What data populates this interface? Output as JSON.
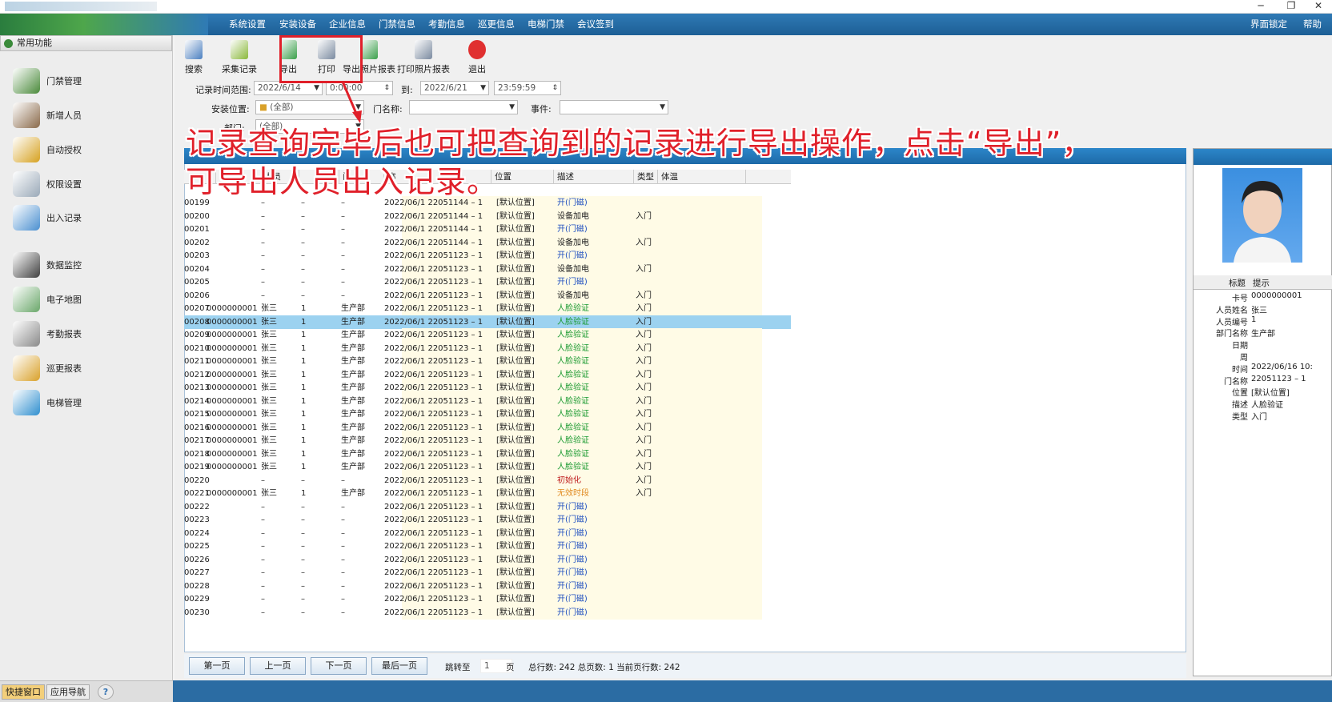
{
  "window": {
    "controls": [
      "─",
      "❐",
      "✕"
    ]
  },
  "menu": {
    "items": [
      "系统设置",
      "安装设备",
      "企业信息",
      "门禁信息",
      "考勤信息",
      "巡更信息",
      "电梯门禁",
      "会议签到"
    ],
    "right": [
      "界面锁定",
      "帮助"
    ]
  },
  "sidebar": {
    "header": "常用功能",
    "items": [
      {
        "label": "门禁管理",
        "icon": "door-control-icon",
        "color": "#4a8a3a"
      },
      {
        "label": "新增人员",
        "icon": "add-person-icon",
        "color": "#8a6a4a"
      },
      {
        "label": "自动授权",
        "icon": "auto-auth-icon",
        "color": "#d6a11f"
      },
      {
        "label": "权限设置",
        "icon": "permission-icon",
        "color": "#9aa9b8"
      },
      {
        "label": "出入记录",
        "icon": "access-record-icon",
        "color": "#4a8fd0"
      },
      {
        "label": "数据监控",
        "icon": "camera-icon",
        "color": "#404040"
      },
      {
        "label": "电子地图",
        "icon": "map-icon",
        "color": "#6aa76a"
      },
      {
        "label": "考勤报表",
        "icon": "clock-icon",
        "color": "#8a8a8a"
      },
      {
        "label": "巡更报表",
        "icon": "patrol-icon",
        "color": "#d9a12a"
      },
      {
        "label": "电梯管理",
        "icon": "elevator-icon",
        "color": "#2f8fcf"
      }
    ],
    "bottom": [
      "快捷窗口",
      "应用导航",
      "?"
    ]
  },
  "toolbar": {
    "buttons": [
      {
        "label": "搜索",
        "icon": "search-icon",
        "color": "#4a7fc0"
      },
      {
        "label": "采集记录",
        "icon": "collect-icon",
        "color": "#8ab83a"
      },
      {
        "label": "导出",
        "icon": "export-icon",
        "color": "#3aa04a"
      },
      {
        "label": "打印",
        "icon": "print-icon",
        "color": "#7a8aa0"
      },
      {
        "label": "导出照片报表",
        "icon": "export-photo-icon",
        "color": "#3aa04a"
      },
      {
        "label": "打印照片报表",
        "icon": "print-photo-icon",
        "color": "#7a8aa0"
      },
      {
        "label": "退出",
        "icon": "power-icon",
        "color": "#e03030"
      }
    ]
  },
  "filters": {
    "time_range_label": "记录时间范围:",
    "start_date": "2022/6/14",
    "start_time": "0:00:00",
    "to_label": "到:",
    "end_date": "2022/6/21",
    "end_time": "23:59:59",
    "location_label": "安装位置:",
    "location_value": "(全部)",
    "door_label": "门名称:",
    "door_value": "",
    "event_label": "事件:",
    "event_value": "",
    "dept_label": "部门:",
    "dept_value": "(全部)"
  },
  "annotation": {
    "line1": "记录查询完毕后也可把查询到的记录进行导出操作，点击“导出”，",
    "line2": "可导出人员出入记录。"
  },
  "grid": {
    "columns": [
      "",
      "",
      "人员",
      "",
      "门",
      "称",
      "位置",
      "描述",
      "类型",
      "体温"
    ],
    "rows": [
      {
        "no": "00199",
        "card": "",
        "name": "–",
        "id": "–",
        "dept": "–",
        "door": "2022/06/1 22051144 – 1",
        "pos": "[默认位置]",
        "desc": "开(门磁)",
        "type": "",
        "color": "#2050c0"
      },
      {
        "no": "00200",
        "card": "",
        "name": "–",
        "id": "–",
        "dept": "–",
        "door": "2022/06/1 22051144 – 1",
        "pos": "[默认位置]",
        "desc": "设备加电",
        "type": "入门",
        "color": "#222"
      },
      {
        "no": "00201",
        "card": "",
        "name": "–",
        "id": "–",
        "dept": "–",
        "door": "2022/06/1 22051144 – 1",
        "pos": "[默认位置]",
        "desc": "开(门磁)",
        "type": "",
        "color": "#2050c0"
      },
      {
        "no": "00202",
        "card": "",
        "name": "–",
        "id": "–",
        "dept": "–",
        "door": "2022/06/1 22051144 – 1",
        "pos": "[默认位置]",
        "desc": "设备加电",
        "type": "入门",
        "color": "#222"
      },
      {
        "no": "00203",
        "card": "",
        "name": "–",
        "id": "–",
        "dept": "–",
        "door": "2022/06/1 22051123 – 1",
        "pos": "[默认位置]",
        "desc": "开(门磁)",
        "type": "",
        "color": "#2050c0"
      },
      {
        "no": "00204",
        "card": "",
        "name": "–",
        "id": "–",
        "dept": "–",
        "door": "2022/06/1 22051123 – 1",
        "pos": "[默认位置]",
        "desc": "设备加电",
        "type": "入门",
        "color": "#222"
      },
      {
        "no": "00205",
        "card": "",
        "name": "–",
        "id": "–",
        "dept": "–",
        "door": "2022/06/1 22051123 – 1",
        "pos": "[默认位置]",
        "desc": "开(门磁)",
        "type": "",
        "color": "#2050c0"
      },
      {
        "no": "00206",
        "card": "",
        "name": "–",
        "id": "–",
        "dept": "–",
        "door": "2022/06/1 22051123 – 1",
        "pos": "[默认位置]",
        "desc": "设备加电",
        "type": "入门",
        "color": "#222"
      },
      {
        "no": "00207",
        "card": "0000000001",
        "name": "张三",
        "id": "1",
        "dept": "生产部",
        "door": "2022/06/1 22051123 – 1",
        "pos": "[默认位置]",
        "desc": "人脸验证",
        "type": "入门",
        "color": "#1a9a30"
      },
      {
        "no": "00208",
        "card": "0000000001",
        "name": "张三",
        "id": "1",
        "dept": "生产部",
        "door": "2022/06/1 22051123 – 1",
        "pos": "[默认位置]",
        "desc": "人脸验证",
        "type": "入门",
        "color": "#1a9a30",
        "selected": true
      },
      {
        "no": "00209",
        "card": "0000000001",
        "name": "张三",
        "id": "1",
        "dept": "生产部",
        "door": "2022/06/1 22051123 – 1",
        "pos": "[默认位置]",
        "desc": "人脸验证",
        "type": "入门",
        "color": "#1a9a30"
      },
      {
        "no": "00210",
        "card": "0000000001",
        "name": "张三",
        "id": "1",
        "dept": "生产部",
        "door": "2022/06/1 22051123 – 1",
        "pos": "[默认位置]",
        "desc": "人脸验证",
        "type": "入门",
        "color": "#1a9a30"
      },
      {
        "no": "00211",
        "card": "0000000001",
        "name": "张三",
        "id": "1",
        "dept": "生产部",
        "door": "2022/06/1 22051123 – 1",
        "pos": "[默认位置]",
        "desc": "人脸验证",
        "type": "入门",
        "color": "#1a9a30"
      },
      {
        "no": "00212",
        "card": "0000000001",
        "name": "张三",
        "id": "1",
        "dept": "生产部",
        "door": "2022/06/1 22051123 – 1",
        "pos": "[默认位置]",
        "desc": "人脸验证",
        "type": "入门",
        "color": "#1a9a30"
      },
      {
        "no": "00213",
        "card": "0000000001",
        "name": "张三",
        "id": "1",
        "dept": "生产部",
        "door": "2022/06/1 22051123 – 1",
        "pos": "[默认位置]",
        "desc": "人脸验证",
        "type": "入门",
        "color": "#1a9a30"
      },
      {
        "no": "00214",
        "card": "0000000001",
        "name": "张三",
        "id": "1",
        "dept": "生产部",
        "door": "2022/06/1 22051123 – 1",
        "pos": "[默认位置]",
        "desc": "人脸验证",
        "type": "入门",
        "color": "#1a9a30"
      },
      {
        "no": "00215",
        "card": "0000000001",
        "name": "张三",
        "id": "1",
        "dept": "生产部",
        "door": "2022/06/1 22051123 – 1",
        "pos": "[默认位置]",
        "desc": "人脸验证",
        "type": "入门",
        "color": "#1a9a30"
      },
      {
        "no": "00216",
        "card": "0000000001",
        "name": "张三",
        "id": "1",
        "dept": "生产部",
        "door": "2022/06/1 22051123 – 1",
        "pos": "[默认位置]",
        "desc": "人脸验证",
        "type": "入门",
        "color": "#1a9a30"
      },
      {
        "no": "00217",
        "card": "0000000001",
        "name": "张三",
        "id": "1",
        "dept": "生产部",
        "door": "2022/06/1 22051123 – 1",
        "pos": "[默认位置]",
        "desc": "人脸验证",
        "type": "入门",
        "color": "#1a9a30"
      },
      {
        "no": "00218",
        "card": "0000000001",
        "name": "张三",
        "id": "1",
        "dept": "生产部",
        "door": "2022/06/1 22051123 – 1",
        "pos": "[默认位置]",
        "desc": "人脸验证",
        "type": "入门",
        "color": "#1a9a30"
      },
      {
        "no": "00219",
        "card": "0000000001",
        "name": "张三",
        "id": "1",
        "dept": "生产部",
        "door": "2022/06/1 22051123 – 1",
        "pos": "[默认位置]",
        "desc": "人脸验证",
        "type": "入门",
        "color": "#1a9a30"
      },
      {
        "no": "00220",
        "card": "",
        "name": "–",
        "id": "–",
        "dept": "–",
        "door": "2022/06/1 22051123 – 1",
        "pos": "[默认位置]",
        "desc": "初始化",
        "type": "入门",
        "color": "#c02020"
      },
      {
        "no": "00221",
        "card": "0000000001",
        "name": "张三",
        "id": "1",
        "dept": "生产部",
        "door": "2022/06/1 22051123 – 1",
        "pos": "[默认位置]",
        "desc": "无效时段",
        "type": "入门",
        "color": "#e08a20"
      },
      {
        "no": "00222",
        "card": "",
        "name": "–",
        "id": "–",
        "dept": "–",
        "door": "2022/06/1 22051123 – 1",
        "pos": "[默认位置]",
        "desc": "开(门磁)",
        "type": "",
        "color": "#2050c0"
      },
      {
        "no": "00223",
        "card": "",
        "name": "–",
        "id": "–",
        "dept": "–",
        "door": "2022/06/1 22051123 – 1",
        "pos": "[默认位置]",
        "desc": "开(门磁)",
        "type": "",
        "color": "#2050c0"
      },
      {
        "no": "00224",
        "card": "",
        "name": "–",
        "id": "–",
        "dept": "–",
        "door": "2022/06/1 22051123 – 1",
        "pos": "[默认位置]",
        "desc": "开(门磁)",
        "type": "",
        "color": "#2050c0"
      },
      {
        "no": "00225",
        "card": "",
        "name": "–",
        "id": "–",
        "dept": "–",
        "door": "2022/06/1 22051123 – 1",
        "pos": "[默认位置]",
        "desc": "开(门磁)",
        "type": "",
        "color": "#2050c0"
      },
      {
        "no": "00226",
        "card": "",
        "name": "–",
        "id": "–",
        "dept": "–",
        "door": "2022/06/1 22051123 – 1",
        "pos": "[默认位置]",
        "desc": "开(门磁)",
        "type": "",
        "color": "#2050c0"
      },
      {
        "no": "00227",
        "card": "",
        "name": "–",
        "id": "–",
        "dept": "–",
        "door": "2022/06/1 22051123 – 1",
        "pos": "[默认位置]",
        "desc": "开(门磁)",
        "type": "",
        "color": "#2050c0"
      },
      {
        "no": "00228",
        "card": "",
        "name": "–",
        "id": "–",
        "dept": "–",
        "door": "2022/06/1 22051123 – 1",
        "pos": "[默认位置]",
        "desc": "开(门磁)",
        "type": "",
        "color": "#2050c0"
      },
      {
        "no": "00229",
        "card": "",
        "name": "–",
        "id": "–",
        "dept": "–",
        "door": "2022/06/1 22051123 – 1",
        "pos": "[默认位置]",
        "desc": "开(门磁)",
        "type": "",
        "color": "#2050c0"
      },
      {
        "no": "00230",
        "card": "",
        "name": "–",
        "id": "–",
        "dept": "–",
        "door": "2022/06/1 22051123 – 1",
        "pos": "[默认位置]",
        "desc": "开(门磁)",
        "type": "",
        "color": "#2050c0"
      }
    ]
  },
  "pager": {
    "first": "第一页",
    "prev": "上一页",
    "next": "下一页",
    "last": "最后一页",
    "jump_label": "跳转至",
    "page_value": "1",
    "page_unit": "页",
    "summary": "总行数: 242 总页数: 1 当前页行数: 242"
  },
  "detail": {
    "col_title": "标题",
    "col_hint": "提示",
    "fields": [
      {
        "k": "卡号",
        "v": "0000000001"
      },
      {
        "k": "人员姓名",
        "v": "张三"
      },
      {
        "k": "人员编号",
        "v": "1"
      },
      {
        "k": "部门名称",
        "v": "生产部"
      },
      {
        "k": "日期",
        "v": ""
      },
      {
        "k": "周",
        "v": ""
      },
      {
        "k": "时间",
        "v": "2022/06/16 10:"
      },
      {
        "k": "门名称",
        "v": "22051123 – 1"
      },
      {
        "k": "位置",
        "v": "[默认位置]"
      },
      {
        "k": "描述",
        "v": "人脸验证"
      },
      {
        "k": "类型",
        "v": "入门"
      }
    ]
  }
}
